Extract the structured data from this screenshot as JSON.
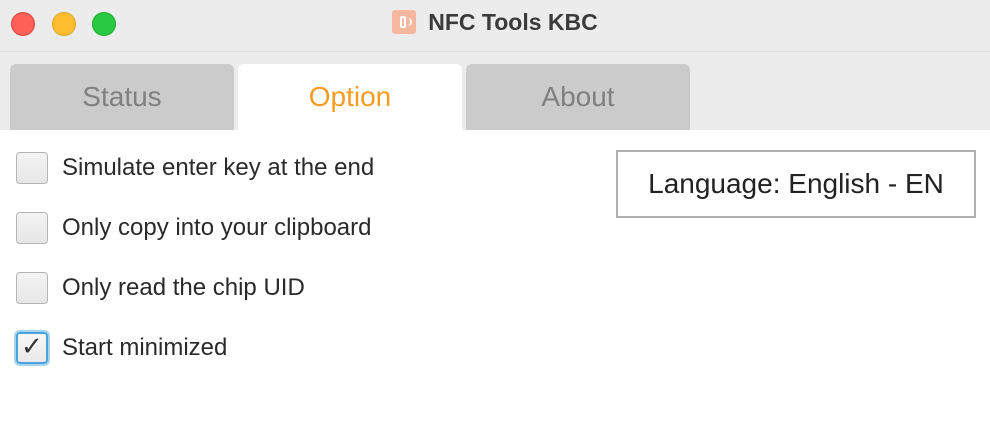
{
  "window": {
    "title": "NFC Tools KBC",
    "app_icon": "nfc-app-icon"
  },
  "tabs": [
    {
      "label": "Status",
      "selected": false
    },
    {
      "label": "Option",
      "selected": true
    },
    {
      "label": "About",
      "selected": false
    }
  ],
  "options": [
    {
      "label": "Simulate enter key at the end",
      "checked": false
    },
    {
      "label": "Only copy into your clipboard",
      "checked": false
    },
    {
      "label": "Only read the chip UID",
      "checked": false
    },
    {
      "label": "Start minimized",
      "checked": true
    }
  ],
  "language_button": {
    "label": "Language: English - EN"
  },
  "colors": {
    "active_tab_text": "#f59c21",
    "inactive_tab_text": "#808080",
    "inactive_tab_bg": "#cbcbcb",
    "focus_ring": "#4aa3dc",
    "close": "#fe5f57",
    "minimize": "#febc2e",
    "zoom": "#28c840"
  },
  "icons": {
    "checkmark": "✓"
  }
}
